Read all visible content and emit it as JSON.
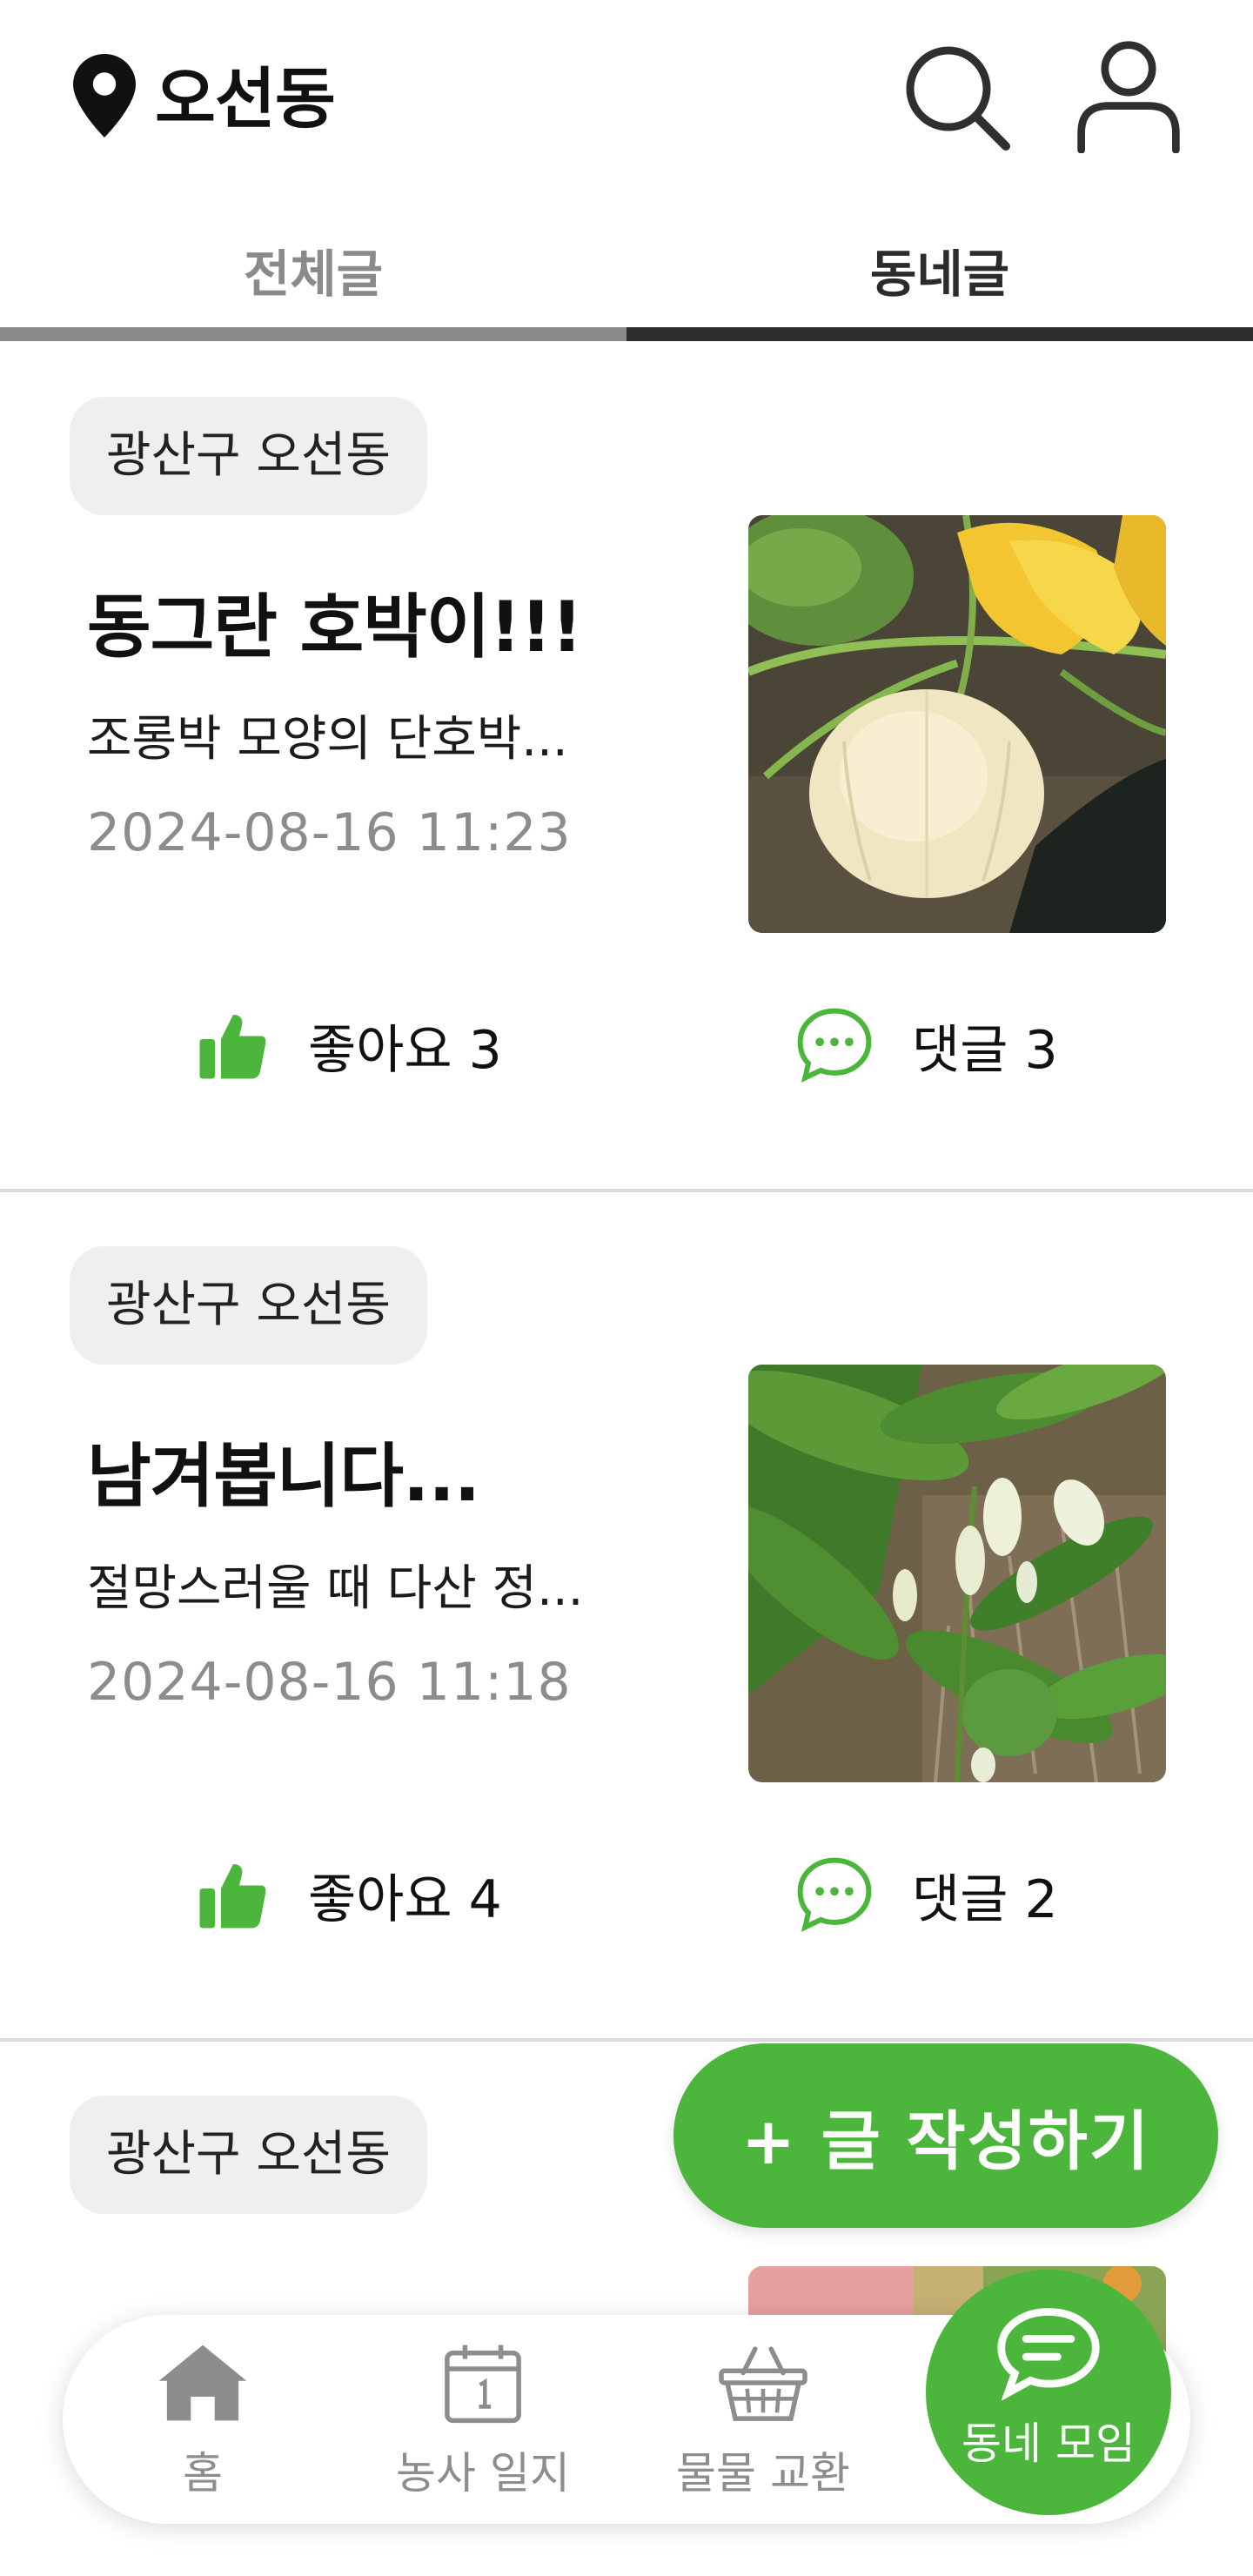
{
  "header": {
    "location": "오선동",
    "icons": {
      "location": "location-pin-icon",
      "search": "search-icon",
      "profile": "user-icon"
    }
  },
  "tabs": [
    {
      "label": "전체글",
      "active": false
    },
    {
      "label": "동네글",
      "active": true
    }
  ],
  "posts": [
    {
      "region": "광산구 오선동",
      "title": "동그란 호박이!!!",
      "snippet": "조롱박 모양의 단호박...",
      "date": "2024-08-16 11:23",
      "like_label": "좋아요 3",
      "comment_label": "댓글 3",
      "image": "pumpkin-photo"
    },
    {
      "region": "광산구 오선동",
      "title": "남겨봅니다...",
      "snippet": "절망스러울 때 다산 정...",
      "date": "2024-08-16 11:18",
      "like_label": "좋아요 4",
      "comment_label": "댓글 2",
      "image": "flower-photo"
    },
    {
      "region": "광산구 오선동"
    }
  ],
  "fab": {
    "label": "+ 글 작성하기"
  },
  "nav": [
    {
      "label": "홈",
      "icon": "home-icon"
    },
    {
      "label": "농사 일지",
      "icon": "calendar-icon"
    },
    {
      "label": "물물 교환",
      "icon": "basket-icon"
    },
    {
      "label": "동네 모임",
      "icon": "chat-icon",
      "active": true
    }
  ],
  "colors": {
    "accent": "#4cb63c",
    "muted": "#8a8a8a",
    "text": "#111111"
  }
}
